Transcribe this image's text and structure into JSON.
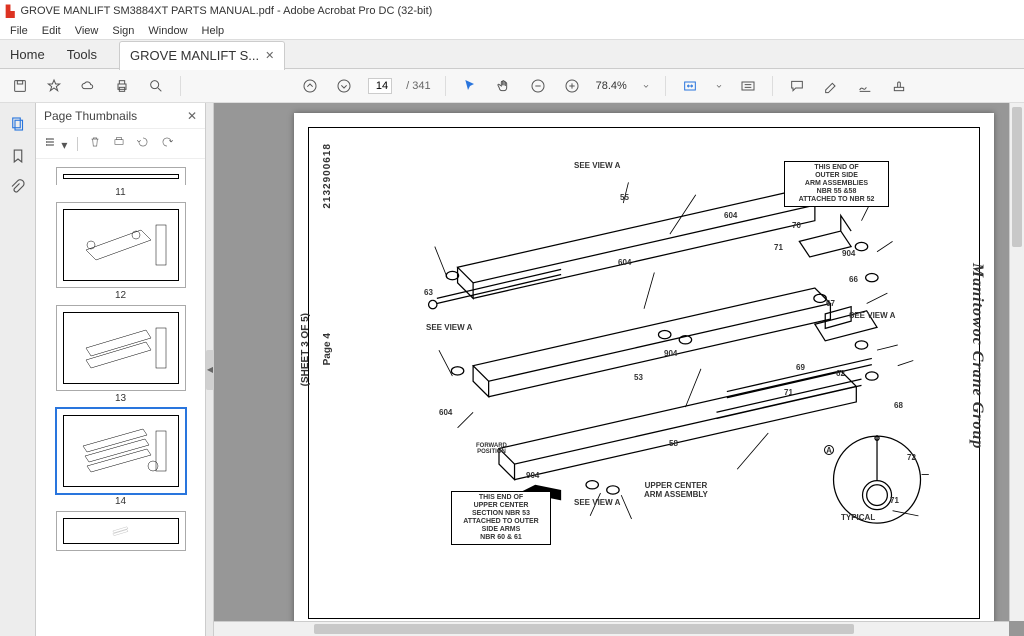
{
  "title": "GROVE MANLIFT SM3884XT PARTS MANUAL.pdf - Adobe Acrobat Pro DC (32-bit)",
  "menu": {
    "file": "File",
    "edit": "Edit",
    "view": "View",
    "sign": "Sign",
    "window": "Window",
    "help": "Help"
  },
  "tabs": {
    "home": "Home",
    "tools": "Tools",
    "doc": "GROVE MANLIFT S..."
  },
  "toolbar": {
    "page_current": "14",
    "page_total": "/ 341",
    "zoom": "78.4%"
  },
  "thumbnails": {
    "title": "Page Thumbnails",
    "p11": "11",
    "p12": "12",
    "p13": "13",
    "p14": "14"
  },
  "page": {
    "right_label": "Manitowoc Crane Group",
    "left_num": "2132900618",
    "sheet": "(SHEET 3 OF 5)",
    "pagelabel": "Page 4",
    "box_top": "THIS END OF\nOUTER SIDE\nARM ASSEMBLIES\nNBR 55 &58\nATTACHED TO NBR 52",
    "box_bottom": "THIS END OF\nUPPER CENTER\nSECTION NBR 53\nATTACHED TO OUTER\nSIDE ARMS\nNBR 60 & 61",
    "upper_center": "UPPER CENTER\nARM ASSEMBLY",
    "forward": "FORWARD\nPOSITION",
    "typical": "TYPICAL",
    "see_a": "SEE\nVIEW\nA"
  },
  "parts": {
    "p53": "53",
    "p55": "55",
    "p58": "58",
    "p62": "62",
    "p63": "63",
    "p66": "66",
    "p67": "67",
    "p68": "68",
    "p69": "69",
    "p70": "70",
    "p71": "71",
    "p72": "72",
    "p604": "604",
    "p904": "904",
    "pA": "A"
  }
}
